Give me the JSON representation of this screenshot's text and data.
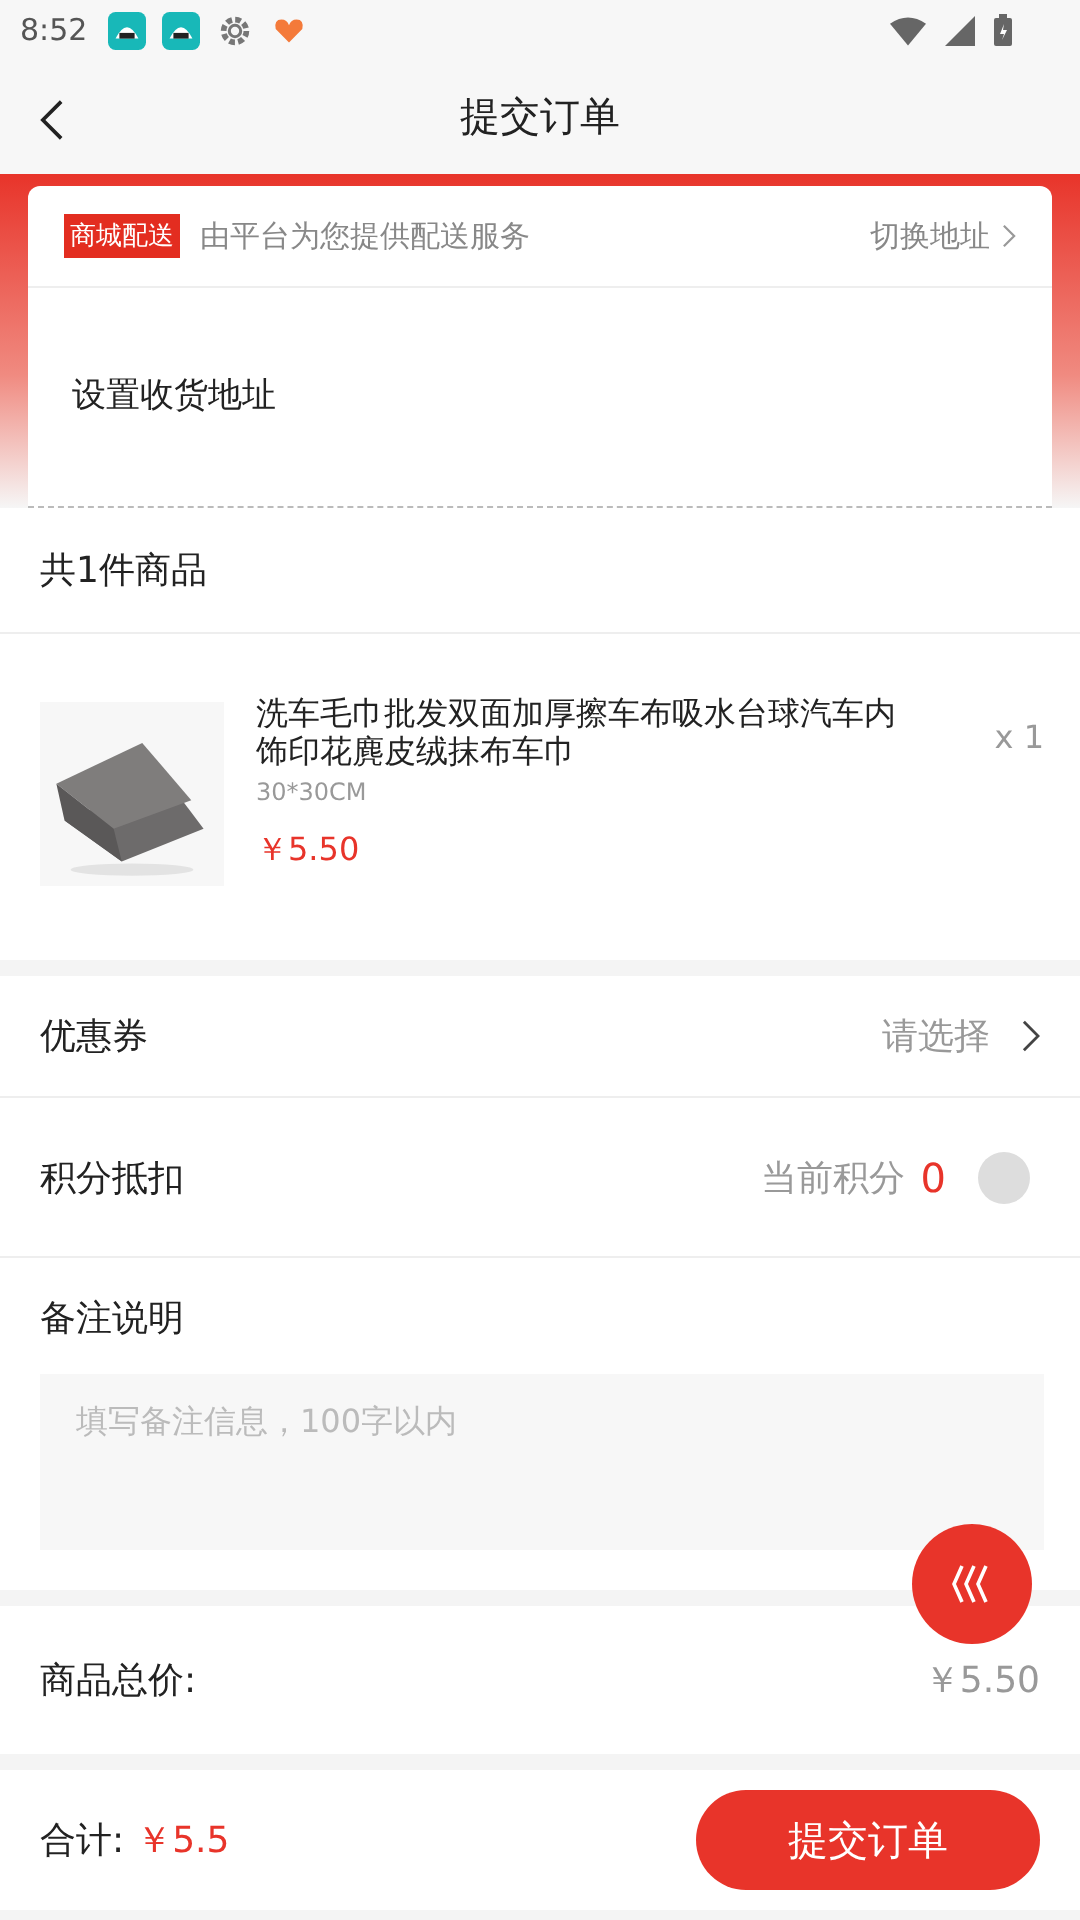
{
  "status_bar": {
    "time": "8:52"
  },
  "header": {
    "title": "提交订单"
  },
  "delivery": {
    "tag": "商城配送",
    "note": "由平台为您提供配送服务",
    "switch_label": "切换地址",
    "address": "设置收货地址"
  },
  "goods": {
    "count_label": "共1件商品",
    "items": [
      {
        "name": "洗车毛巾批发双面加厚擦车布吸水台球汽车内饰印花麂皮绒抹布车巾",
        "spec": "30*30CM",
        "price": "￥5.50",
        "quantity": "x 1"
      }
    ]
  },
  "coupon": {
    "label": "优惠券",
    "value": "请选择"
  },
  "points": {
    "label": "积分抵扣",
    "caption": "当前积分",
    "amount": "0",
    "on": false
  },
  "remark": {
    "label": "备注说明",
    "placeholder": "填写备注信息，100字以内"
  },
  "subtotal": {
    "label": "商品总价:",
    "value": "￥5.50"
  },
  "footer": {
    "total_label": "合计:",
    "total": "￥5.5",
    "submit": "提交订单"
  }
}
